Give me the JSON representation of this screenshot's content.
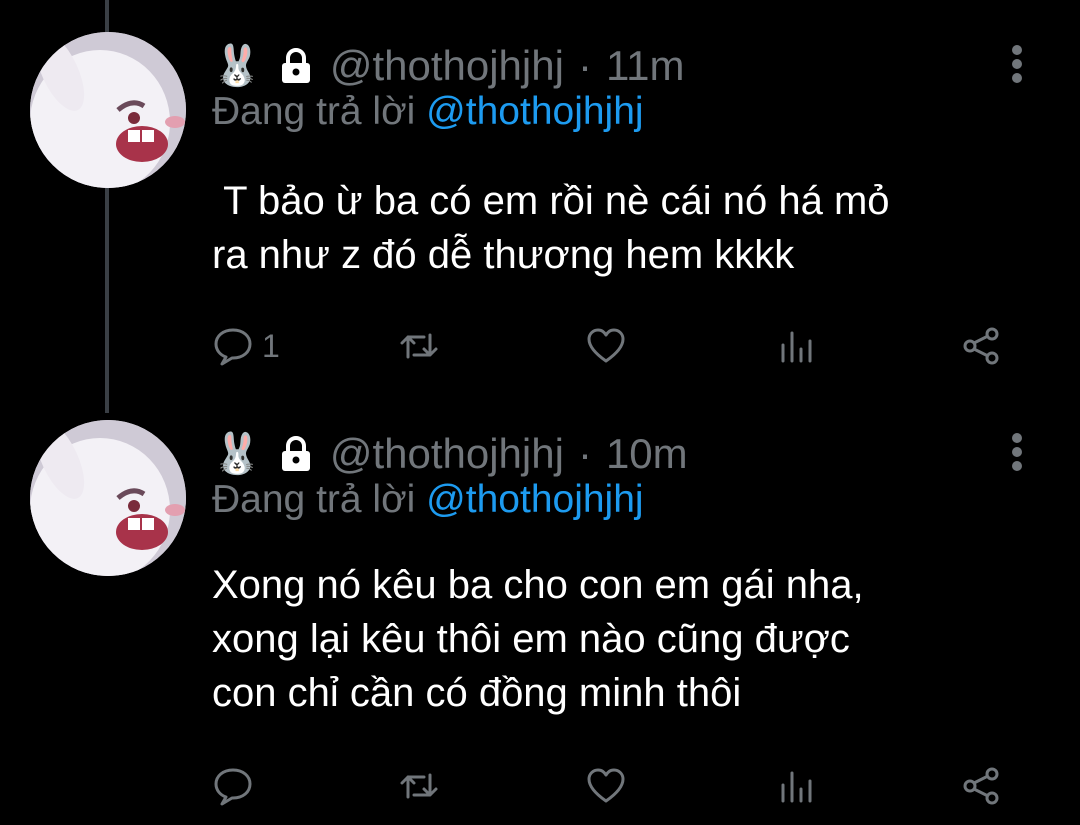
{
  "colors": {
    "background": "#000000",
    "muted": "#71767b",
    "link": "#1d9bf0",
    "text": "#ffffff",
    "thread_line": "#3a3f45"
  },
  "tweets": [
    {
      "name_emoji": "🐰",
      "handle": "@thothojhjhj",
      "separator": "·",
      "time": "11m",
      "replying_prefix": "Đang trả lời",
      "replying_to": "@thothojhjhj",
      "text": " T bảo ừ ba có em rồi nè cái nó há mỏ\nra như z đó dễ thương hem kkkk",
      "reply_count": "1",
      "icons": [
        "rabbit-icon",
        "lock-icon",
        "more-icon",
        "reply-icon",
        "retweet-icon",
        "like-icon",
        "views-icon",
        "share-icon"
      ]
    },
    {
      "name_emoji": "🐰",
      "handle": "@thothojhjhj",
      "separator": "·",
      "time": "10m",
      "replying_prefix": "Đang trả lời",
      "replying_to": "@thothojhjhj",
      "text": "Xong nó kêu ba cho con em gái nha,\nxong lại kêu thôi em nào cũng được\ncon chỉ cần có đồng minh thôi",
      "reply_count": "",
      "icons": [
        "rabbit-icon",
        "lock-icon",
        "more-icon",
        "reply-icon",
        "retweet-icon",
        "like-icon",
        "views-icon",
        "share-icon"
      ]
    }
  ]
}
